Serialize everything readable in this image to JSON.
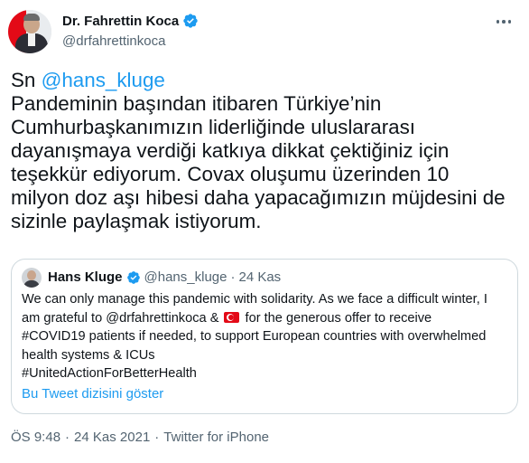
{
  "author": {
    "name": "Dr. Fahrettin Koca",
    "handle": "@drfahrettinkoca"
  },
  "tweet": {
    "prefix": "Sn ",
    "mention": "@hans_kluge",
    "lines": [
      "Pandeminin başından itibaren Türkiye’nin",
      "Cumhurbaşkanımızın liderliğinde uluslararası",
      "dayanışmaya verdiği katkıya dikkat çektiğiniz için",
      "teşekkür ediyorum. Covax oluşumu üzerinden 10",
      "milyon doz aşı hibesi daha yapacağımızın müjdesini de",
      "sizinle paylaşmak istiyorum."
    ]
  },
  "quote": {
    "name": "Hans Kluge",
    "handle": "@hans_kluge",
    "separator": "·",
    "date": "24 Kas",
    "line1": "We can only manage this pandemic with solidarity. As we face a difficult winter, I",
    "line2_before": "am grateful to @drfahrettinkoca & ",
    "line2_after": " for the generous offer to receive",
    "line3": "#COVID19 patients if needed, to support European countries with overwhelmed",
    "line4": "health systems & ICUs",
    "line5": "#UnitedActionForBetterHealth",
    "show_thread": "Bu Tweet dizisini göster",
    "flag_icon": "turkey-flag-icon"
  },
  "meta": {
    "time": "ÖS 9:48",
    "separator1": "·",
    "date": "24 Kas 2021",
    "separator2": "·",
    "source": "Twitter for iPhone"
  },
  "colors": {
    "link": "#1d9bf0",
    "secondary_text": "#536471",
    "border": "#cfd9de",
    "verified": "#1d9bf0"
  }
}
